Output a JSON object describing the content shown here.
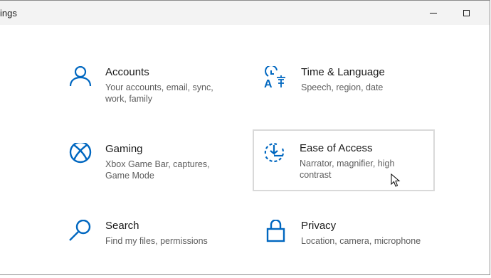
{
  "window": {
    "title": "ings",
    "minimize_icon": "minimize-icon",
    "maximize_icon": "maximize-icon"
  },
  "accent_color": "#0067c0",
  "tiles": [
    {
      "name": "Accounts",
      "description": "Your accounts, email, sync, work, family",
      "icon": "person-icon"
    },
    {
      "name": "Time & Language",
      "description": "Speech, region, date",
      "icon": "time-language-icon"
    },
    {
      "name": "Gaming",
      "description": "Xbox Game Bar, captures, Game Mode",
      "icon": "xbox-icon"
    },
    {
      "name": "Ease of Access",
      "description": "Narrator, magnifier, high contrast",
      "icon": "ease-of-access-icon",
      "hovered": true
    },
    {
      "name": "Search",
      "description": "Find my files, permissions",
      "icon": "search-icon"
    },
    {
      "name": "Privacy",
      "description": "Location, camera, microphone",
      "icon": "lock-icon"
    }
  ]
}
